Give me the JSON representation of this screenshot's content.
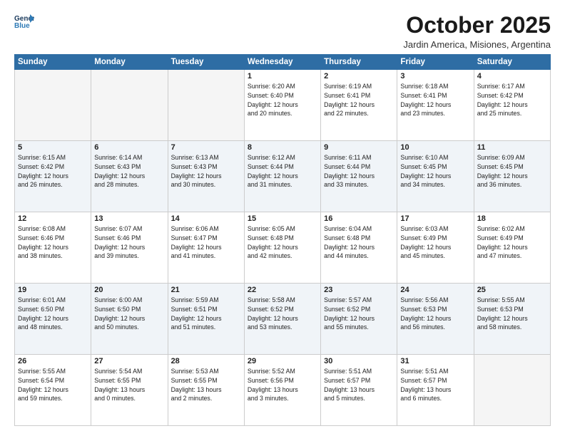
{
  "header": {
    "logo_line1": "General",
    "logo_line2": "Blue",
    "month": "October 2025",
    "location": "Jardin America, Misiones, Argentina"
  },
  "weekdays": [
    "Sunday",
    "Monday",
    "Tuesday",
    "Wednesday",
    "Thursday",
    "Friday",
    "Saturday"
  ],
  "weeks": [
    [
      {
        "day": "",
        "info": ""
      },
      {
        "day": "",
        "info": ""
      },
      {
        "day": "",
        "info": ""
      },
      {
        "day": "1",
        "info": "Sunrise: 6:20 AM\nSunset: 6:40 PM\nDaylight: 12 hours\nand 20 minutes."
      },
      {
        "day": "2",
        "info": "Sunrise: 6:19 AM\nSunset: 6:41 PM\nDaylight: 12 hours\nand 22 minutes."
      },
      {
        "day": "3",
        "info": "Sunrise: 6:18 AM\nSunset: 6:41 PM\nDaylight: 12 hours\nand 23 minutes."
      },
      {
        "day": "4",
        "info": "Sunrise: 6:17 AM\nSunset: 6:42 PM\nDaylight: 12 hours\nand 25 minutes."
      }
    ],
    [
      {
        "day": "5",
        "info": "Sunrise: 6:15 AM\nSunset: 6:42 PM\nDaylight: 12 hours\nand 26 minutes."
      },
      {
        "day": "6",
        "info": "Sunrise: 6:14 AM\nSunset: 6:43 PM\nDaylight: 12 hours\nand 28 minutes."
      },
      {
        "day": "7",
        "info": "Sunrise: 6:13 AM\nSunset: 6:43 PM\nDaylight: 12 hours\nand 30 minutes."
      },
      {
        "day": "8",
        "info": "Sunrise: 6:12 AM\nSunset: 6:44 PM\nDaylight: 12 hours\nand 31 minutes."
      },
      {
        "day": "9",
        "info": "Sunrise: 6:11 AM\nSunset: 6:44 PM\nDaylight: 12 hours\nand 33 minutes."
      },
      {
        "day": "10",
        "info": "Sunrise: 6:10 AM\nSunset: 6:45 PM\nDaylight: 12 hours\nand 34 minutes."
      },
      {
        "day": "11",
        "info": "Sunrise: 6:09 AM\nSunset: 6:45 PM\nDaylight: 12 hours\nand 36 minutes."
      }
    ],
    [
      {
        "day": "12",
        "info": "Sunrise: 6:08 AM\nSunset: 6:46 PM\nDaylight: 12 hours\nand 38 minutes."
      },
      {
        "day": "13",
        "info": "Sunrise: 6:07 AM\nSunset: 6:46 PM\nDaylight: 12 hours\nand 39 minutes."
      },
      {
        "day": "14",
        "info": "Sunrise: 6:06 AM\nSunset: 6:47 PM\nDaylight: 12 hours\nand 41 minutes."
      },
      {
        "day": "15",
        "info": "Sunrise: 6:05 AM\nSunset: 6:48 PM\nDaylight: 12 hours\nand 42 minutes."
      },
      {
        "day": "16",
        "info": "Sunrise: 6:04 AM\nSunset: 6:48 PM\nDaylight: 12 hours\nand 44 minutes."
      },
      {
        "day": "17",
        "info": "Sunrise: 6:03 AM\nSunset: 6:49 PM\nDaylight: 12 hours\nand 45 minutes."
      },
      {
        "day": "18",
        "info": "Sunrise: 6:02 AM\nSunset: 6:49 PM\nDaylight: 12 hours\nand 47 minutes."
      }
    ],
    [
      {
        "day": "19",
        "info": "Sunrise: 6:01 AM\nSunset: 6:50 PM\nDaylight: 12 hours\nand 48 minutes."
      },
      {
        "day": "20",
        "info": "Sunrise: 6:00 AM\nSunset: 6:50 PM\nDaylight: 12 hours\nand 50 minutes."
      },
      {
        "day": "21",
        "info": "Sunrise: 5:59 AM\nSunset: 6:51 PM\nDaylight: 12 hours\nand 51 minutes."
      },
      {
        "day": "22",
        "info": "Sunrise: 5:58 AM\nSunset: 6:52 PM\nDaylight: 12 hours\nand 53 minutes."
      },
      {
        "day": "23",
        "info": "Sunrise: 5:57 AM\nSunset: 6:52 PM\nDaylight: 12 hours\nand 55 minutes."
      },
      {
        "day": "24",
        "info": "Sunrise: 5:56 AM\nSunset: 6:53 PM\nDaylight: 12 hours\nand 56 minutes."
      },
      {
        "day": "25",
        "info": "Sunrise: 5:55 AM\nSunset: 6:53 PM\nDaylight: 12 hours\nand 58 minutes."
      }
    ],
    [
      {
        "day": "26",
        "info": "Sunrise: 5:55 AM\nSunset: 6:54 PM\nDaylight: 12 hours\nand 59 minutes."
      },
      {
        "day": "27",
        "info": "Sunrise: 5:54 AM\nSunset: 6:55 PM\nDaylight: 13 hours\nand 0 minutes."
      },
      {
        "day": "28",
        "info": "Sunrise: 5:53 AM\nSunset: 6:55 PM\nDaylight: 13 hours\nand 2 minutes."
      },
      {
        "day": "29",
        "info": "Sunrise: 5:52 AM\nSunset: 6:56 PM\nDaylight: 13 hours\nand 3 minutes."
      },
      {
        "day": "30",
        "info": "Sunrise: 5:51 AM\nSunset: 6:57 PM\nDaylight: 13 hours\nand 5 minutes."
      },
      {
        "day": "31",
        "info": "Sunrise: 5:51 AM\nSunset: 6:57 PM\nDaylight: 13 hours\nand 6 minutes."
      },
      {
        "day": "",
        "info": ""
      }
    ]
  ]
}
